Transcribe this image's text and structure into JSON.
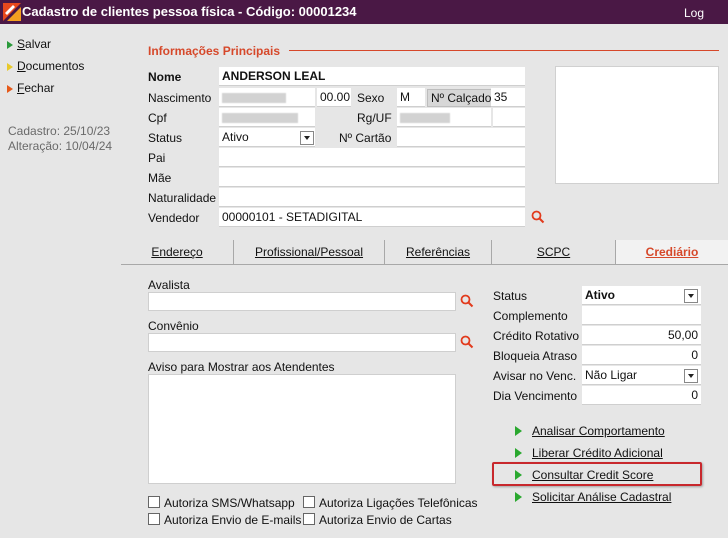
{
  "window": {
    "title": "Cadastro de clientes pessoa física - Código: 00001234",
    "log_label": "Log"
  },
  "sidebar": {
    "items": [
      {
        "label": "Salvar",
        "accel": "S"
      },
      {
        "label": "Documentos",
        "accel": "D"
      },
      {
        "label": "Fechar",
        "accel": "F"
      }
    ],
    "cadastro": "Cadastro: 25/10/23",
    "alteracao": "Alteração: 10/04/24"
  },
  "info": {
    "section_title": "Informações Principais",
    "nome_label": "Nome",
    "nome_value": "ANDERSON LEAL",
    "nascimento_label": "Nascimento",
    "idade_value": "00.00",
    "sexo_label": "Sexo",
    "sexo_value": "M",
    "calcado_label": "Nº Calçado",
    "calcado_value": "35",
    "cpf_label": "Cpf",
    "rguf_label": "Rg/UF",
    "status_label": "Status",
    "status_value": "Ativo",
    "cartao_label": "Nº Cartão",
    "pai_label": "Pai",
    "mae_label": "Mãe",
    "naturalidade_label": "Naturalidade",
    "vendedor_label": "Vendedor",
    "vendedor_value": "00000101 - SETADIGITAL"
  },
  "tabs": [
    "Endereço",
    "Profissional/Pessoal",
    "Referências",
    "SCPC",
    "Crediário"
  ],
  "crediario": {
    "avalista_label": "Avalista",
    "convenio_label": "Convênio",
    "aviso_label": "Aviso para Mostrar aos Atendentes",
    "status_label": "Status",
    "status_value": "Ativo",
    "complemento_label": "Complemento",
    "credito_label": "Crédito Rotativo",
    "credito_value": "50,00",
    "bloqueia_label": "Bloqueia Atraso",
    "bloqueia_value": "0",
    "avisar_label": "Avisar no Venc.",
    "avisar_value": "Não Ligar",
    "dia_label": "Dia Vencimento",
    "dia_value": "0",
    "checks": [
      "Autoriza SMS/Whatsapp",
      "Autoriza Ligações Telefônicas",
      "Autoriza Envio de E-mails",
      "Autoriza Envio de Cartas"
    ],
    "actions": [
      "Analisar Comportamento",
      "Liberar Crédito Adicional",
      "Consultar Credit Score",
      "Solicitar Análise Cadastral"
    ]
  },
  "colors": {
    "titlebar": "#4a1845",
    "accent": "#d6482a",
    "action_arrow": "#2aa82f",
    "highlight": "#c8282d"
  }
}
